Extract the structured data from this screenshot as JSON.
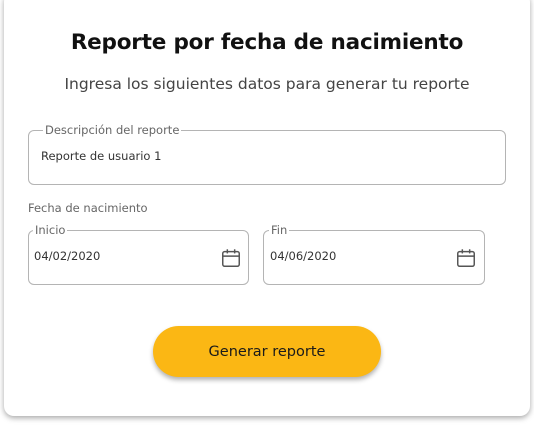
{
  "header": {
    "title": "Reporte por fecha de nacimiento",
    "subtitle": "Ingresa los siguientes datos para generar tu reporte"
  },
  "description_field": {
    "label": "Descripción del reporte",
    "value": "Reporte de usuario 1"
  },
  "birthdate": {
    "label": "Fecha de nacimiento",
    "start": {
      "label": "Inicio",
      "value": "04/02/2020",
      "icon": "calendar-icon"
    },
    "end": {
      "label": "Fin",
      "value": "04/06/2020",
      "icon": "calendar-icon"
    }
  },
  "actions": {
    "generate_label": "Generar reporte"
  },
  "colors": {
    "accent": "#fbb714",
    "border": "#b4b4b4",
    "title": "#111111"
  }
}
